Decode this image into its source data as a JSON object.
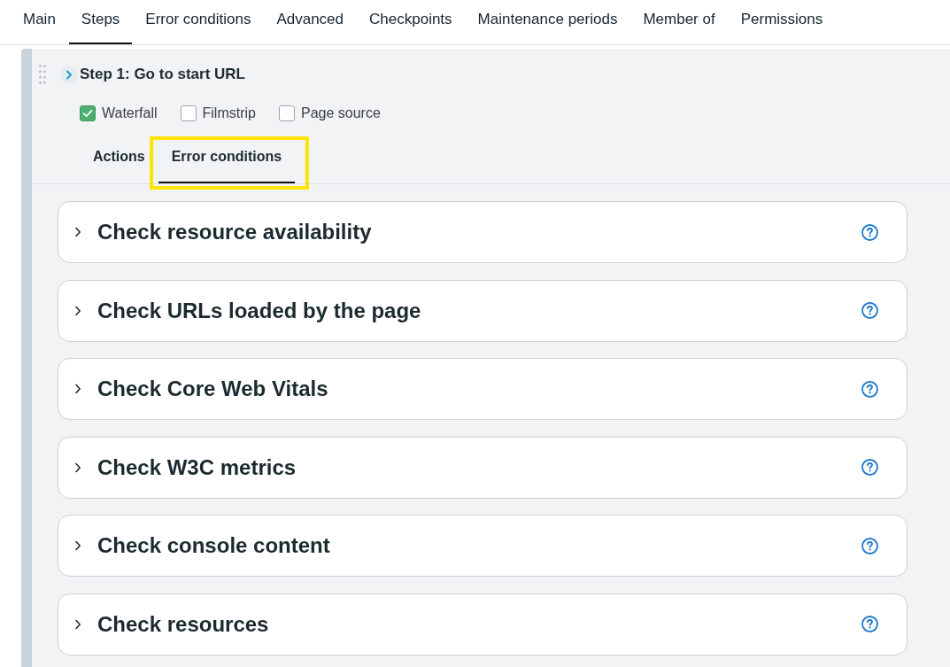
{
  "top_tabs": [
    {
      "label": "Main",
      "selected": false
    },
    {
      "label": "Steps",
      "selected": true
    },
    {
      "label": "Error conditions",
      "selected": false
    },
    {
      "label": "Advanced",
      "selected": false
    },
    {
      "label": "Checkpoints",
      "selected": false
    },
    {
      "label": "Maintenance periods",
      "selected": false
    },
    {
      "label": "Member of",
      "selected": false
    },
    {
      "label": "Permissions",
      "selected": false
    }
  ],
  "step": {
    "title": "Step 1: Go to start URL",
    "expanded": false,
    "options": [
      {
        "label": "Waterfall",
        "checked": true
      },
      {
        "label": "Filmstrip",
        "checked": false
      },
      {
        "label": "Page source",
        "checked": false
      }
    ],
    "tabs": [
      {
        "label": "Actions",
        "selected": false,
        "highlighted": false
      },
      {
        "label": "Error conditions",
        "selected": true,
        "highlighted": true
      }
    ]
  },
  "sections": [
    {
      "title": "Check resource availability",
      "expanded": false
    },
    {
      "title": "Check URLs loaded by the page",
      "expanded": false
    },
    {
      "title": "Check Core Web Vitals",
      "expanded": false
    },
    {
      "title": "Check W3C metrics",
      "expanded": false
    },
    {
      "title": "Check console content",
      "expanded": false
    },
    {
      "title": "Check resources",
      "expanded": false
    }
  ]
}
